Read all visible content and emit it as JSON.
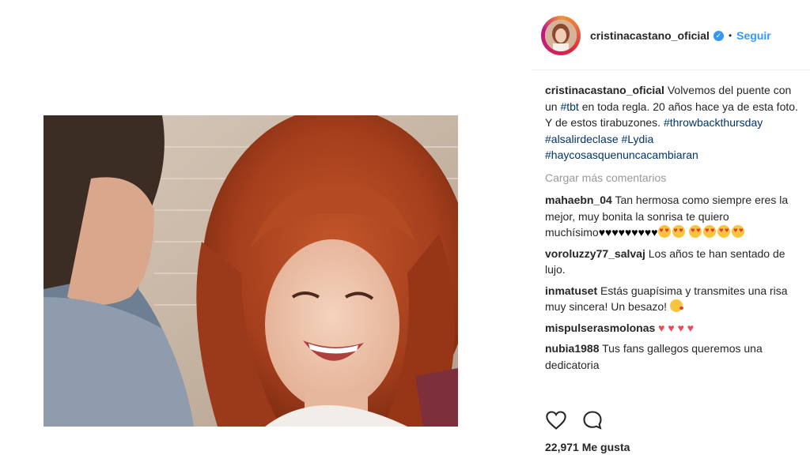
{
  "post": {
    "username": "cristinacastano_oficial",
    "follow_label": "Seguir",
    "separator": "•"
  },
  "caption": {
    "username": "cristinacastano_oficial",
    "text_1": " Volvemos del puente con un ",
    "tag_tbt": "#tbt",
    "text_2": " en toda regla. 20 años hace ya de esta foto. Y de estos tirabuzones. ",
    "tags": [
      "#throwbackthursday",
      "#alsalirdeclase",
      "#Lydia",
      "#haycosasquenuncacambiaran"
    ]
  },
  "load_more_label": "Cargar más comentarios",
  "comments": [
    {
      "user": "mahaebn_04",
      "text": " Tan hermosa como siempre eres la mejor, muy bonita la sonrisa te quiero muchísimo",
      "black_hearts": "♥♥♥♥♥♥♥♥♥",
      "heart_eyes_count": 6
    },
    {
      "user": "voroluzzy77_salvaj",
      "text": " Los años te han sentado de lujo."
    },
    {
      "user": "inmatuset",
      "text": " Estás guapísima y transmites una risa muy sincera! Un besazo! "
    },
    {
      "user": "mispulserasmolonas",
      "text": " ",
      "red_hearts": "♥ ♥ ♥ ♥"
    },
    {
      "user": "nubia1988",
      "text": " Tus fans gallegos queremos una dedicatoria"
    }
  ],
  "actions": {
    "like_icon": "heart-outline-icon",
    "comment_icon": "comment-bubble-icon"
  },
  "likes_label": "22,971 Me gusta"
}
